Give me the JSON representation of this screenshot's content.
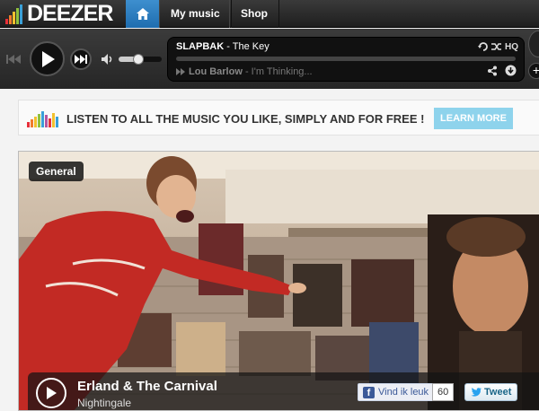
{
  "nav": {
    "logo_text": "DEEZER",
    "items": [
      {
        "label": "My music"
      },
      {
        "label": "Shop"
      }
    ]
  },
  "player": {
    "now_playing": {
      "artist": "SLAPBAK",
      "separator": " - ",
      "title": "The Key"
    },
    "next_up": {
      "artist": "Lou Barlow",
      "separator": " - ",
      "title": "I'm Thinking..."
    },
    "quality_label": "HQ",
    "volume_level": 0.45,
    "progress": 0.0
  },
  "banner": {
    "text": "LISTEN TO ALL THE MUSIC YOU LIKE, SIMPLY AND FOR FREE !",
    "cta_label": "LEARN MORE"
  },
  "feature": {
    "category": "General",
    "title": "Erland & The Carnival",
    "subtitle": "Nightingale",
    "fb_like_label": "Vind ik leuk",
    "fb_like_count": "60",
    "tweet_label": "Tweet"
  },
  "colors": {
    "brand_bars": [
      "#e72f39",
      "#f07b2d",
      "#f2c12e",
      "#8fc13e",
      "#3aa0d8",
      "#b257a2"
    ],
    "accent_blue": "#2a7fc1",
    "cta": "#8ed3ec"
  }
}
